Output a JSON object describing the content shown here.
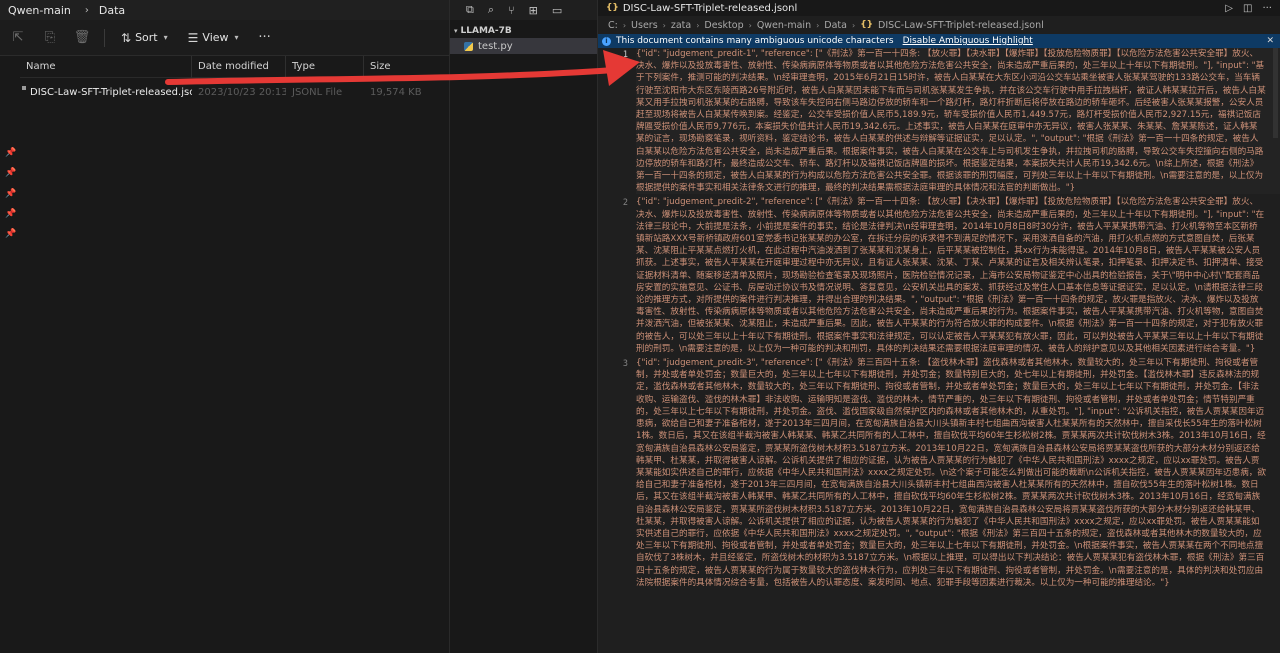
{
  "explorer": {
    "breadcrumb": [
      "Qwen-main",
      "Data"
    ],
    "toolbar": {
      "sort_label": "Sort",
      "view_label": "View"
    },
    "columns": [
      "Name",
      "Date modified",
      "Type",
      "Size"
    ],
    "files": [
      {
        "name": "DISC-Law-SFT-Triplet-released.jsonl",
        "date": "2023/10/23 20:13",
        "type": "JSONL File",
        "size": "19,574 KB"
      }
    ]
  },
  "vscode": {
    "section_title": "LLAMA-7B",
    "tree": [
      {
        "label": "test.py"
      }
    ]
  },
  "editor": {
    "tab_label": "DISC-Law-SFT-Triplet-released.jsonl",
    "breadcrumb": [
      "C:",
      "Users",
      "zata",
      "Desktop",
      "Qwen-main",
      "Data",
      "DISC-Law-SFT-Triplet-released.jsonl"
    ],
    "banner_text": "This document contains many ambiguous unicode characters",
    "banner_link": "Disable Ambiguous Highlight",
    "lines": [
      {
        "number": "1",
        "text": "{\"id\": \"judgement_predit-1\", \"reference\": [\"《刑法》第一百一十四条: 【放火罪】【决水罪】【爆炸罪】【投放危险物质罪】【以危险方法危害公共安全罪】放火、决水、爆炸以及投放毒害性、放射性、传染病病原体等物质或者以其他危险方法危害公共安全，尚未造成严重后果的，处三年以上十年以下有期徒刑。\"], \"input\": \"基于下列案件，推测可能的判决结果。\\n经审理查明，2015年6月21日15时许，被告人白某某在大东区小河沿公交车站乘坐被害人张某某驾驶的133路公交车，当车辆行驶至沈阳市大东区东陵西路26号附近时，被告人白某某因未能下车而与司机张某某发生争执，并在该公交车行驶中用手拉拽档杆，被证人韩某某拉开后，被告人白某某又用手拉拽司机张某某的右胳膊，导致该车失控向右侧马路边停放的轿车和一个路灯杆，路灯杆折断后将停放在路边的轿车砸坏。后经被害人张某某报警，公安人员赶至现场将被告人白某某传唤到案。经鉴定，公交车受损价值人民币5,189.9元，轿车受损价值人民币1,449.57元，路灯杆受损价值人民币2,927.15元，福祺记饭店牌匾受损价值人民币9,776元，本案损失价值共计人民币19,342.6元。上述事实，被告人白某某在庭审中亦无异议，被害人张某某、朱某某、詹某某陈述，证人韩某某的证言，现场勘察笔录，视听资料，鉴定结论书，被告人白某某的供述与辩解等证据证实，足以认定。\", \"output\": \"根据《刑法》第一百一十四条的规定，被告人白某某以危险方法危害公共安全，尚未造成严重后果。根据案件事实，被告人白某某在公交车上与司机发生争执，并拉拽司机的胳膊，导致公交车失控撞向右侧的马路边停放的轿车和路灯杆，最终造成公交车、轿车、路灯杆以及福祺记饭店牌匾的损坏。根据鉴定结果，本案损失共计人民币19,342.6元。\\n综上所述，根据《刑法》第一百一十四条的规定，被告人白某某的行为构成以危险方法危害公共安全罪。根据该罪的刑罚幅度，可判处三年以上十年以下有期徒刑。\\n需要注意的是，以上仅为根据提供的案件事实和相关法律条文进行的推理，最终的判决结果需根据法庭审理的具体情况和法官的判断做出。\"}"
      },
      {
        "number": "2",
        "text": "{\"id\": \"judgement_predit-2\", \"reference\": [\"《刑法》第一百一十四条: 【放火罪】【决水罪】【爆炸罪】【投放危险物质罪】【以危险方法危害公共安全罪】放火、决水、爆炸以及投放毒害性、放射性、传染病病原体等物质或者以其他危险方法危害公共安全，尚未造成严重后果的，处三年以上十年以下有期徒刑。\"], \"input\": \"在法律三段论中，大前提是法条，小前提是案件的事实，结论是法律判决\\n经审理查明，2014年10月8日8时30分许，被告人平某某携带汽油、打火机等物至本区新桥镇新站路XXX号新桥镇政府601室党委书记张某某的办公室，在拆迁分房的诉求得不到满足的情况下，采用泼洒自备的汽油，用打火机点燃的方式意图自焚，后张某某、沈某阻止平某某点燃打火机，在此过程中汽油泼洒到了张某某和沈某身上，后平某某被控制住，其xx行为未能得逞。2014年10月8日，被告人平某某被公安人员抓获。上述事实，被告人平某某在开庭审理过程中亦无异议，且有证人张某某、沈某、丁某、卢某某的证言及相关辨认笔录，扣押笔录、扣押决定书、扣押清单、接受证据材料清单、随案移送清单及照片，现场勘验检查笔录及现场照片，医院检验情况记录，上海市公安局物证鉴定中心出具的检验报告，关于\\\"明中中心村\\\"配套商品房安置的实施意见、公证书、房屋动迁协议书及情况说明、答复意见，公安机关出具的案发、抓获经过及常住人口基本信息等证据证实，足以认定。\\n请根据法律三段论的推理方式，对所提供的案件进行判决推理，并得出合理的判决结果。\", \"output\": \"根据《刑法》第一百一十四条的规定，放火罪是指放火、决水、爆炸以及投放毒害性、放射性、传染病病原体等物质或者以其他危险方法危害公共安全，尚未造成严重后果的行为。根据案件事实，被告人平某某携带汽油、打火机等物，意图自焚并泼洒汽油，但被张某某、沈某阻止，未造成严重后果。因此，被告人平某某的行为符合放火罪的构成要件。\\n根据《刑法》第一百一十四条的规定，对于犯有放火罪的被告人，可以处三年以上十年以下有期徒刑。根据案件事实和法律规定，可以认定被告人平某某犯有放火罪，因此，可以判处被告人平某某三年以上十年以下有期徒刑的刑罚。\\n需要注意的是，以上仅为一种可能的判决和刑罚，具体的判决结果还需要根据法庭审理的情况、被告人的辩护意见以及其他相关因素进行综合考量。\"}"
      },
      {
        "number": "3",
        "text": "{\"id\": \"judgement_predit-3\", \"reference\": [\"《刑法》第三百四十五条: 【盗伐林木罪】盗伐森林或者其他林木，数量较大的，处三年以下有期徒刑、拘役或者管制，并处或者单处罚金；数量巨大的，处三年以上七年以下有期徒刑，并处罚金；数量特别巨大的，处七年以上有期徒刑，并处罚金。【滥伐林木罪】违反森林法的规定，滥伐森林或者其他林木，数量较大的，处三年以下有期徒刑、拘役或者管制，并处或者单处罚金；数量巨大的，处三年以上七年以下有期徒刑，并处罚金。【非法收购、运输盗伐、滥伐的林木罪】非法收购、运输明知是盗伐、滥伐的林木，情节严重的，处三年以下有期徒刑、拘役或者管制，并处或者单处罚金；情节特别严重的，处三年以上七年以下有期徒刑，并处罚金。盗伐、滥伐国家级自然保护区内的森林或者其他林木的，从重处罚。\"], \"input\": \"公诉机关指控，被告人贾某某因年迈患病，欲给自己和妻子准备棺材，遂于2013年三四月间，在宽甸满族自治县大川头镇新丰村七组曲西沟被害人杜某某所有的天然林中，擅自采伐长55年生的落叶松树1株。数日后，其又在该组半截沟被害人韩某某、韩某乙共同所有的人工林中，擅自砍伐平均60年生杉松树2株。贾某某两次共计砍伐树木3株。2013年10月16日，经宽甸满族自治县森林公安局鉴定，贾某某所盗伐树木材积3.5187立方米。2013年10月22日，宽甸满族自治县森林公安局将贾某某盗伐所获的大部分木材分别返还给韩某甲、杜某某，并取得被害人谅解。公诉机关提供了相应的证据，认为被告人贾某某的行为触犯了《中华人民共和国刑法》xxxx之规定，应以xx罪处罚。被告人贾某某能如实供述自己的罪行，应依据《中华人民共和国刑法》xxxx之规定处罚。\\n这个案子可能怎么判做出可能的裁断\\n公诉机关指控，被告人贾某某因年迈患病，欲给自己和妻子准备棺材，遂于2013年三四月间，在宽甸满族自治县大川头镇新丰村七组曲西沟被害人杜某某所有的天然林中，擅自砍伐55年生的落叶松树1株。数日后，其又在该组半截沟被害人韩某甲、韩某乙共同所有的人工林中，擅自砍伐平均60年生杉松树2株。贾某某两次共计砍伐树木3株。2013年10月16日，经宽甸满族自治县森林公安局鉴定，贾某某所盗伐树木材积3.5187立方米。2013年10月22日，宽甸满族自治县森林公安局将贾某某盗伐所获的大部分木材分别返还给韩某甲、杜某某，并取得被害人谅解。公诉机关提供了相应的证据，认为被告人贾某某的行为触犯了《中华人民共和国刑法》xxxx之规定，应以xx罪处罚。被告人贾某某能如实供述自己的罪行，应依据《中华人民共和国刑法》xxxx之规定处罚。\", \"output\": \"根据《刑法》第三百四十五条的规定，盗伐森林或者其他林木的数量较大的，应处三年以下有期徒刑、拘役或者管制，并处或者单处罚金；数量巨大的，处三年以上七年以下有期徒刑，并处罚金。\\n根据案件事实，被告人贾某某在两个不同地点擅自砍伐了3株树木，并且经鉴定，所盗伐树木的材积为3.5187立方米。\\n根据以上推理，可以得出以下判决结论：被告人贾某某犯有盗伐林木罪，根据《刑法》第三百四十五条的规定，被告人贾某某的行为属于数量较大的盗伐林木行为，应判处三年以下有期徒刑、拘役或者管制，并处罚金。\\n需要注意的是，具体的判决和处罚应由法院根据案件的具体情况综合考量，包括被告人的认罪态度、案发时间、地点、犯罪手段等因素进行裁决。以上仅为一种可能的推理结论。\"}"
      }
    ]
  }
}
